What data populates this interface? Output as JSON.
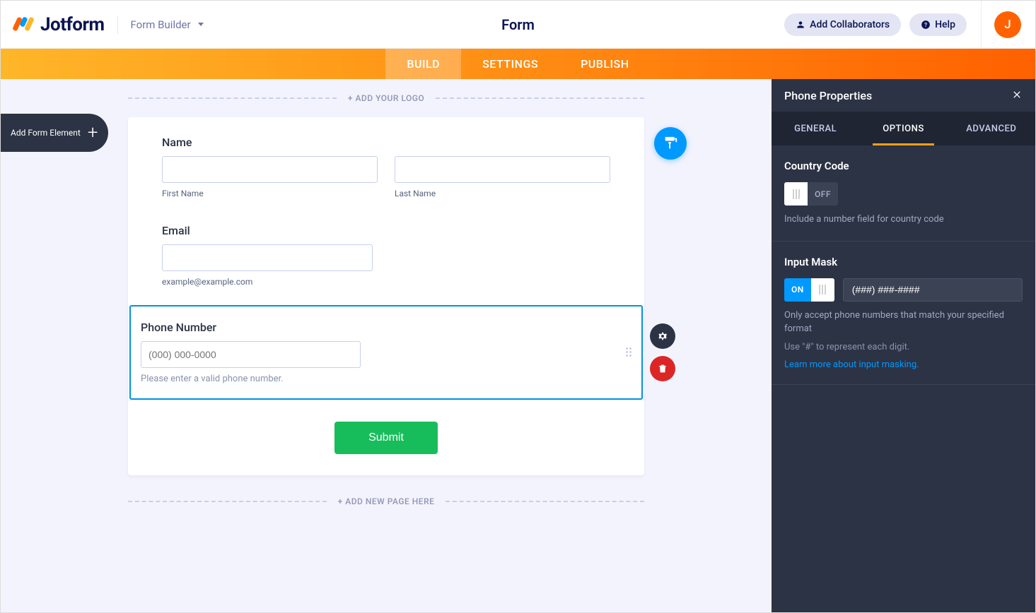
{
  "header": {
    "brand": "Jotform",
    "breadcrumb": "Form Builder",
    "title": "Form",
    "collaborators": "Add Collaborators",
    "help": "Help",
    "avatar_initial": "J"
  },
  "tabs": {
    "build": "BUILD",
    "settings": "SETTINGS",
    "publish": "PUBLISH"
  },
  "canvas": {
    "add_element": "Add Form Element",
    "add_logo": "+ ADD YOUR LOGO",
    "add_page": "+ ADD NEW PAGE HERE"
  },
  "form": {
    "name": {
      "label": "Name",
      "first_sub": "First Name",
      "last_sub": "Last Name"
    },
    "email": {
      "label": "Email",
      "example": "example@example.com"
    },
    "phone": {
      "label": "Phone Number",
      "placeholder": "(000) 000-0000",
      "hint": "Please enter a valid phone number."
    },
    "submit": "Submit"
  },
  "properties": {
    "title": "Phone Properties",
    "tabs": {
      "general": "GENERAL",
      "options": "OPTIONS",
      "advanced": "ADVANCED"
    },
    "country_code": {
      "title": "Country Code",
      "state": "OFF",
      "desc": "Include a number field for country code"
    },
    "input_mask": {
      "title": "Input Mask",
      "state": "ON",
      "value": "(###) ###-####",
      "desc1": "Only accept phone numbers that match your specified format",
      "desc2": "Use \"#\" to represent each digit.",
      "link": "Learn more about input masking."
    }
  }
}
